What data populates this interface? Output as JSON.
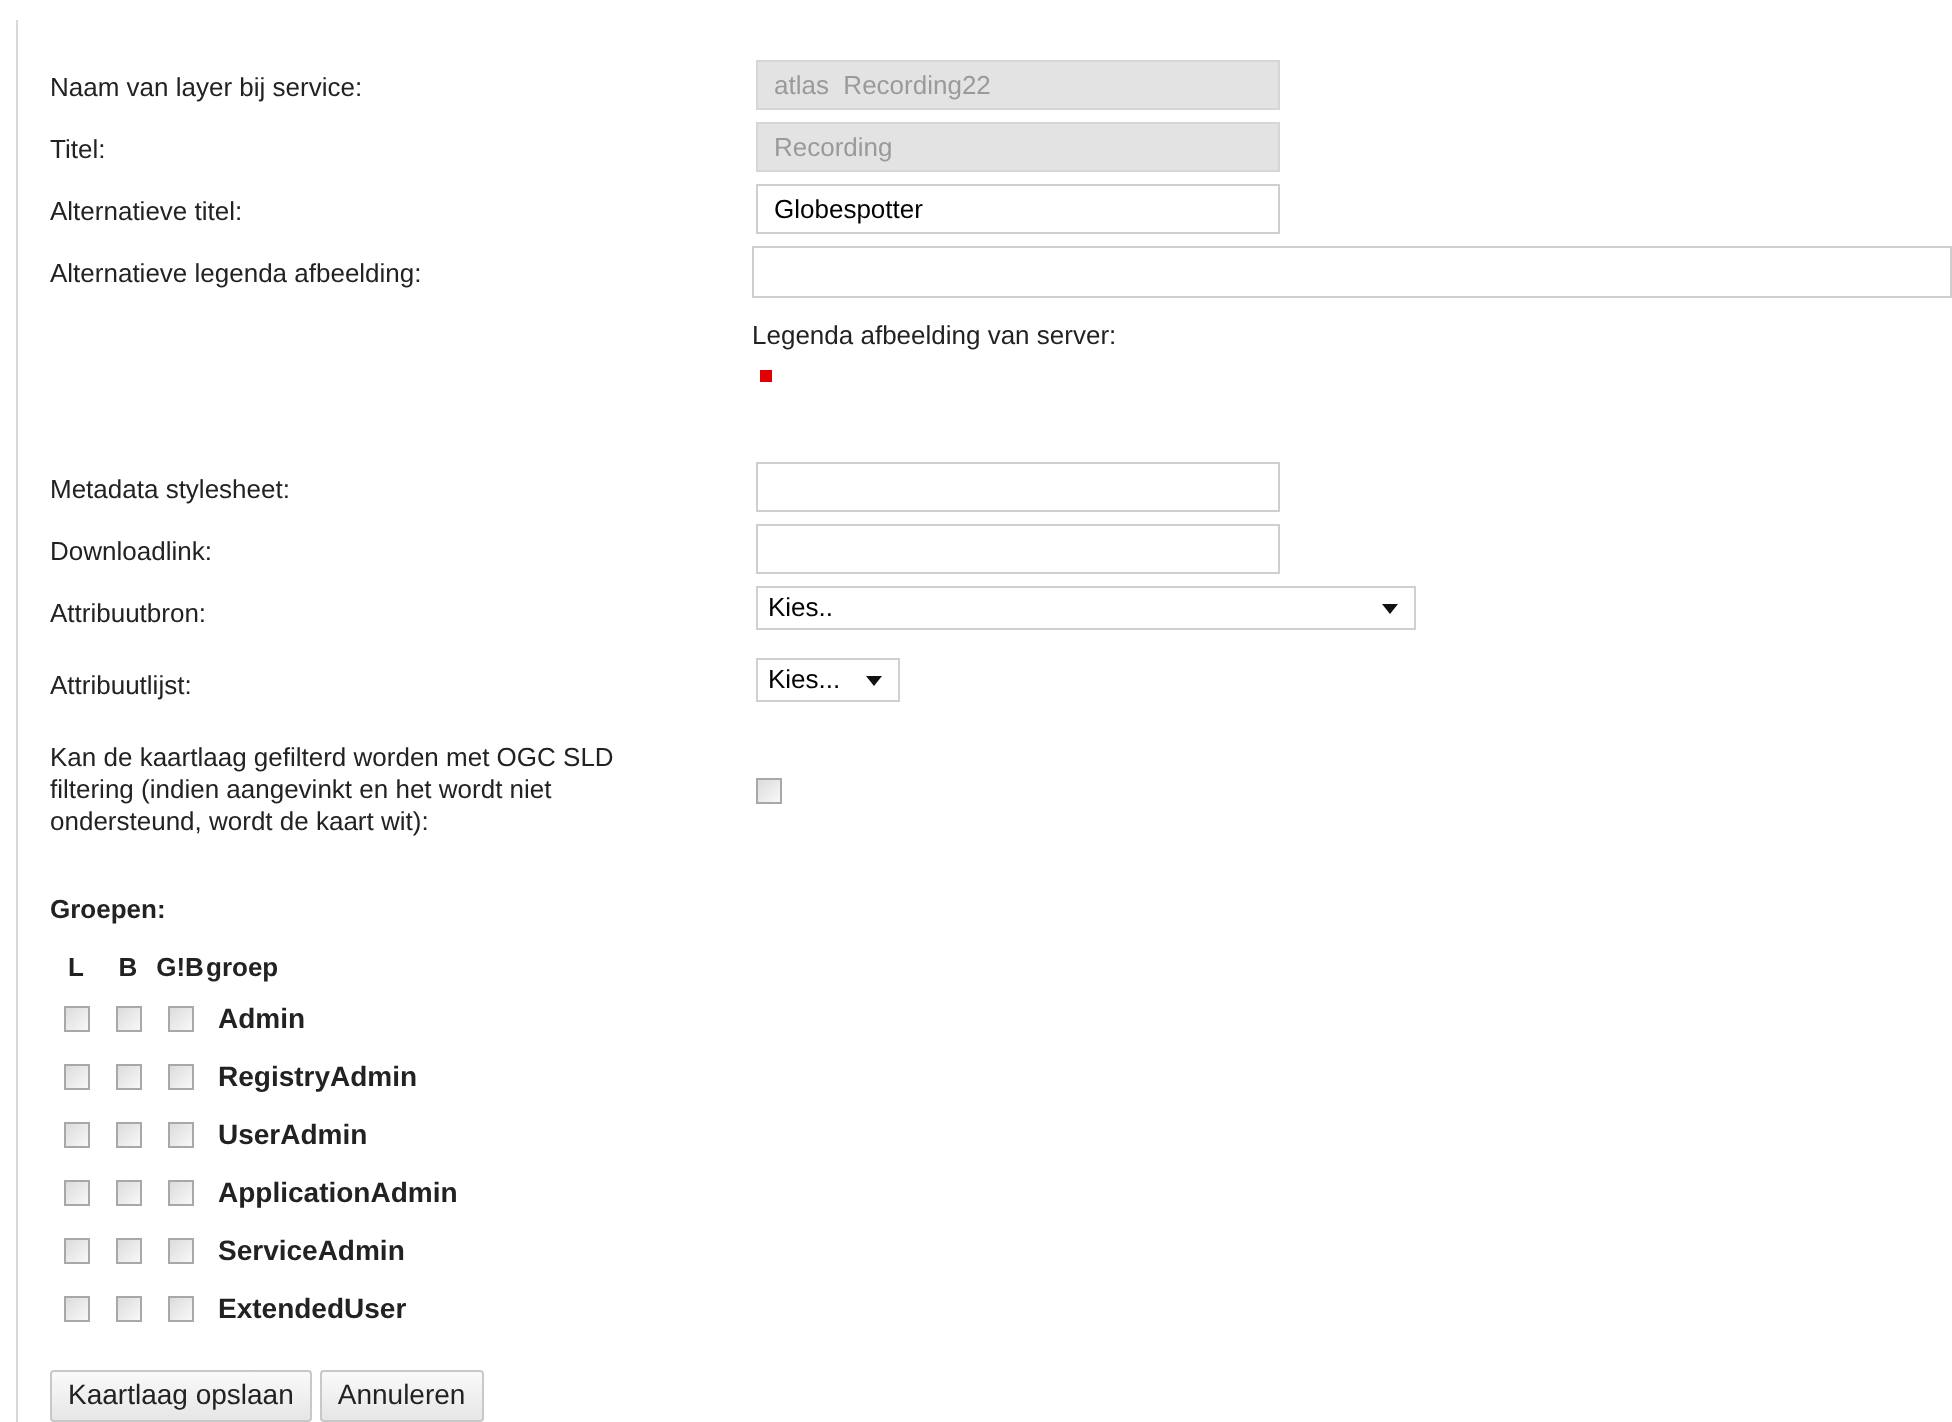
{
  "fields": [
    {
      "kind": "text",
      "label": "Naam van layer bij service:",
      "value": "atlas  Recording22",
      "disabled": true
    },
    {
      "kind": "text",
      "label": "Titel:",
      "value": "Recording",
      "disabled": true
    },
    {
      "kind": "text",
      "label": "Alternatieve titel:",
      "value": "Globespotter",
      "disabled": false
    },
    {
      "kind": "wide",
      "label": "Alternatieve legenda afbeelding:",
      "disabled": false,
      "note": "Legenda afbeelding van server:"
    },
    {
      "kind": "text",
      "label": "Metadata stylesheet:",
      "disabled": false
    },
    {
      "kind": "text",
      "label": "Downloadlink:",
      "disabled": false
    },
    {
      "kind": "select",
      "label": "Attribuutbron:",
      "value": "Kies..",
      "disabled": false
    },
    {
      "kind": "small-select",
      "label": "Attribuutlijst:",
      "value": "Kies...",
      "disabled": false
    },
    {
      "kind": "checkbox",
      "label": "Kan de kaartlaag gefilterd worden met OGC SLD filtering (indien aangevinkt en het wordt niet ondersteund, wordt de kaart wit):",
      "checked": false
    }
  ],
  "groups": {
    "title": "Groepen:",
    "columns": [
      "L",
      "B",
      "G!B",
      "groep"
    ],
    "rows": [
      {
        "name": "Admin",
        "l": false,
        "b": false,
        "gb": false
      },
      {
        "name": "RegistryAdmin",
        "l": false,
        "b": false,
        "gb": false
      },
      {
        "name": "UserAdmin",
        "l": false,
        "b": false,
        "gb": false
      },
      {
        "name": "ApplicationAdmin",
        "l": false,
        "b": false,
        "gb": false
      },
      {
        "name": "ServiceAdmin",
        "l": false,
        "b": false,
        "gb": false
      },
      {
        "name": "ExtendedUser",
        "l": false,
        "b": false,
        "gb": false
      }
    ]
  },
  "buttons": [
    "Kaartlaag opslaan",
    "Annuleren"
  ]
}
